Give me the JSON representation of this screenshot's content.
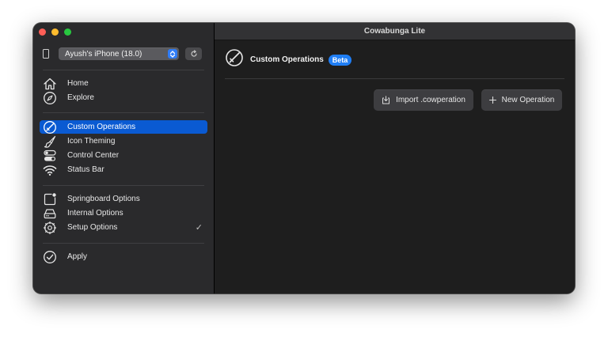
{
  "window": {
    "title": "Cowabunga Lite"
  },
  "sidebar": {
    "device": "Ayush's iPhone (18.0)",
    "groups": [
      {
        "items": [
          {
            "label": "Home",
            "icon": "house-icon"
          },
          {
            "label": "Explore",
            "icon": "compass-icon"
          }
        ]
      },
      {
        "items": [
          {
            "label": "Custom Operations",
            "icon": "custom-operations-icon",
            "selected": true
          },
          {
            "label": "Icon Theming",
            "icon": "paintbrush-icon"
          },
          {
            "label": "Control Center",
            "icon": "switches-icon"
          },
          {
            "label": "Status Bar",
            "icon": "wifi-icon"
          }
        ]
      },
      {
        "items": [
          {
            "label": "Springboard Options",
            "icon": "app-badge-icon"
          },
          {
            "label": "Internal Options",
            "icon": "internal-drive-icon"
          },
          {
            "label": "Setup Options",
            "icon": "gear-icon",
            "checked": true
          }
        ]
      },
      {
        "items": [
          {
            "label": "Apply",
            "icon": "checkmark-circle-icon"
          }
        ]
      }
    ]
  },
  "main": {
    "title": "Custom Operations",
    "badge": "Beta",
    "buttons": {
      "import": "Import .cowperation",
      "new": "New Operation"
    }
  },
  "colors": {
    "accent": "#0a5ad2",
    "badge": "#1f7ef5",
    "sidebar_bg": "#2a2a2c",
    "main_bg": "#1e1e1e"
  }
}
